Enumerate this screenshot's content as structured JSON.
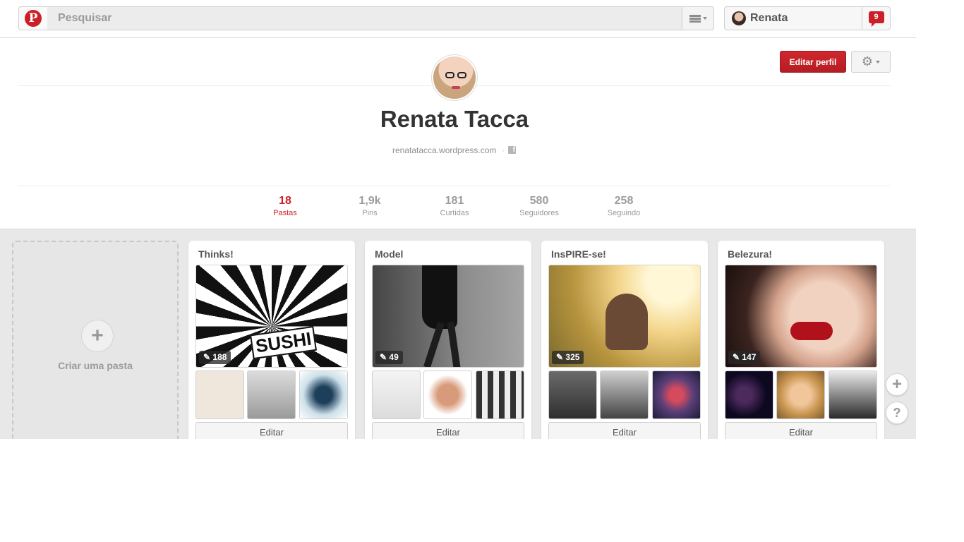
{
  "header": {
    "logo": "P",
    "search_placeholder": "Pesquisar",
    "user_name": "Renata",
    "notification_count": "9"
  },
  "profile": {
    "name": "Renata Tacca",
    "website": "renatatacca.wordpress.com",
    "separator": "·",
    "edit_label": "Editar perfil",
    "stats": [
      {
        "value": "18",
        "label": "Pastas"
      },
      {
        "value": "1,9k",
        "label": "Pins"
      },
      {
        "value": "181",
        "label": "Curtidas"
      },
      {
        "value": "580",
        "label": "Seguidores"
      },
      {
        "value": "258",
        "label": "Seguindo"
      }
    ]
  },
  "boards": {
    "create_label": "Criar uma pasta",
    "items": [
      {
        "title": "Thinks!",
        "pin_count": "188",
        "edit_label": "Editar"
      },
      {
        "title": "Model",
        "pin_count": "49",
        "edit_label": "Editar"
      },
      {
        "title": "InsPIRE-se!",
        "pin_count": "325",
        "edit_label": "Editar"
      },
      {
        "title": "Belezura!",
        "pin_count": "147",
        "edit_label": "Editar"
      }
    ]
  },
  "floating": {
    "add": "+",
    "help": "?"
  },
  "colors": {
    "brand_red": "#cb2027",
    "board_bg": "#e8e8e8"
  },
  "icons": [
    "pinterest-logo-icon",
    "menu-icon",
    "notification-icon",
    "gear-icon",
    "facebook-icon",
    "pin-icon",
    "plus-icon",
    "help-icon"
  ]
}
